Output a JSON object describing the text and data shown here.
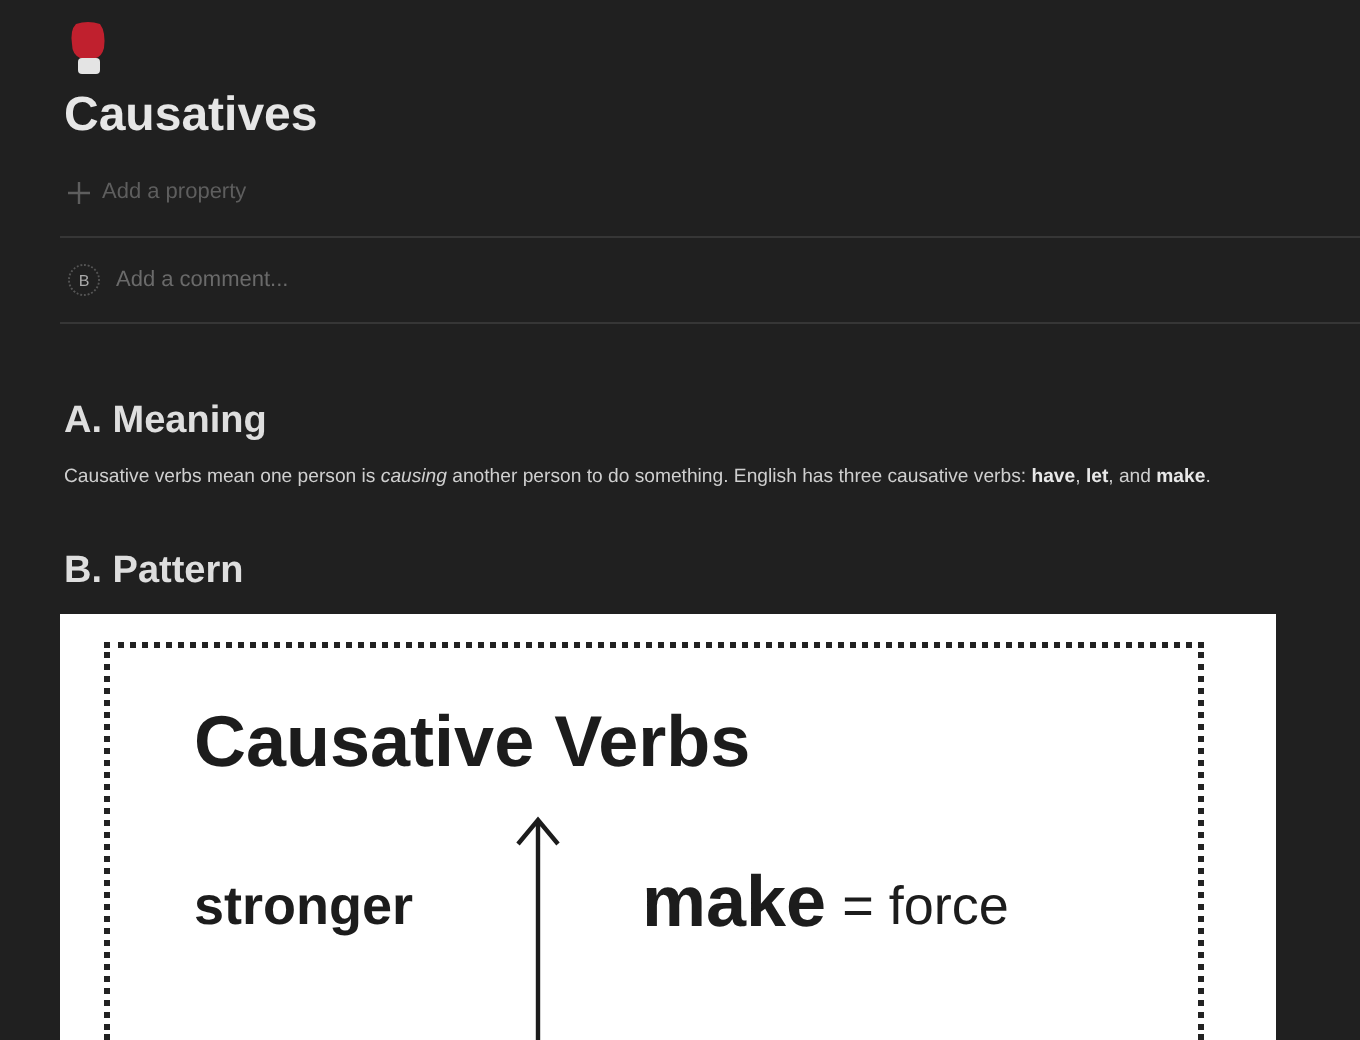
{
  "page": {
    "title": "Causatives",
    "add_property": "Add a property",
    "comment": {
      "avatar_initial": "B",
      "placeholder": "Add a comment..."
    }
  },
  "sections": [
    {
      "heading": "A. Meaning",
      "paragraph": "Causative verbs mean one person is *causing* another person to do something. English has three causative verbs: **have**, **let**, and **make**."
    },
    {
      "heading": "B. Pattern"
    }
  ],
  "figure": {
    "title": "Causative Verbs",
    "left_label": "stronger",
    "verb": "make",
    "meaning": "= force"
  }
}
